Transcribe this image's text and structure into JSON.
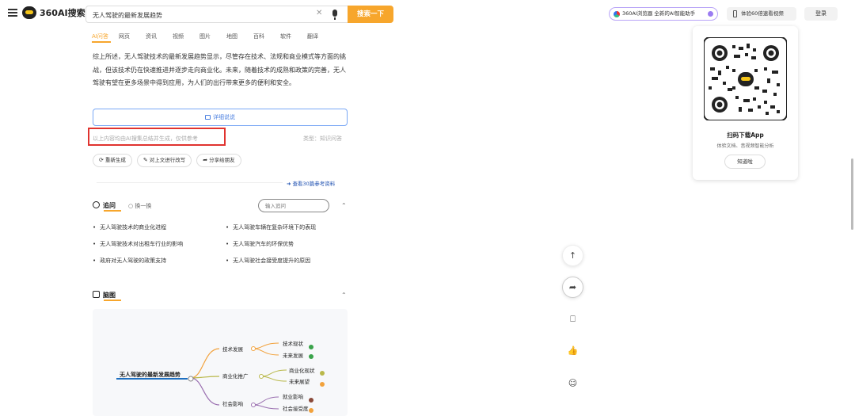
{
  "header": {
    "logo_text": "360AI搜索",
    "search_value": "无人驾驶的最新发展趋势",
    "search_button": "搜索一下",
    "browser_promo": "360AI浏览器 全新的AI智能助手",
    "app_promo": "体验60倍速看视频",
    "login": "登录"
  },
  "tabs": [
    "AI问答",
    "网页",
    "资讯",
    "视频",
    "图片",
    "地图",
    "百科",
    "软件",
    "翻译"
  ],
  "answer": {
    "paragraph": "综上所述，无人驾驶技术的最新发展趋势显示，尽管存在技术、法规和商业模式等方面的挑战，但该技术仍在快速推进并逐步走向商业化。未来，随着技术的成熟和政策的完善，无人驾驶有望在更多场景中得到应用，为人们的出行带来更多的便利和安全。",
    "detail_button": "详细说说",
    "disclaimer": "以上内容均由AI搜集总结并生成，仅供参考",
    "type_label": "类型：知识问答",
    "actions": [
      "重新生成",
      "对上文进行改写",
      "分享给朋友"
    ],
    "references": "查看30篇参考资料"
  },
  "followup": {
    "title": "追问",
    "switch": "换一换",
    "input_placeholder": "输入追问",
    "items": [
      "无人驾驶技术的商业化进程",
      "无人驾驶车辆在复杂环境下的表现",
      "无人驾驶技术对出租车行业的影响",
      "无人驾驶汽车的环保优势",
      "政府对无人驾驶的政策支持",
      "无人驾驶社会接受度提升的原因"
    ]
  },
  "mindmap": {
    "title": "脑图",
    "root": "无人驾驶的最新发展趋势",
    "branches": [
      {
        "label": "技术发展",
        "children": [
          "技术现状",
          "未来发展"
        ]
      },
      {
        "label": "商业化推广",
        "children": [
          "商业化现状",
          "未来展望"
        ]
      },
      {
        "label": "社会影响",
        "children": [
          "就业影响",
          "社会接受度"
        ]
      }
    ],
    "colors": {
      "tech": "#f2a23c",
      "biz": "#b9b84a",
      "soc": "#9a6fb0",
      "root": "#1e6fc0"
    }
  },
  "qr_panel": {
    "title": "扫码下载App",
    "subtitle": "体验文档、音视频智能分析",
    "button": "知道啦"
  },
  "floating": {
    "icons": [
      "arrow-up-icon",
      "share-icon",
      "bookmark-icon",
      "thumbs-up-icon",
      "feedback-icon"
    ]
  }
}
